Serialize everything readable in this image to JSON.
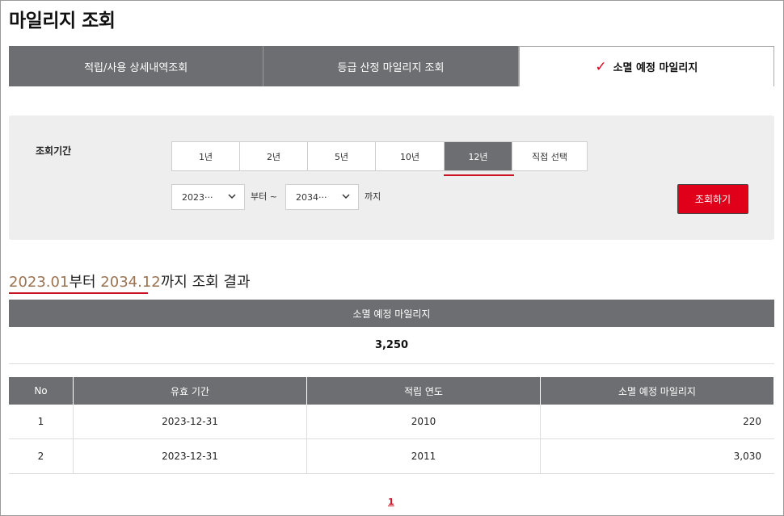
{
  "page": {
    "title": "마일리지 조회"
  },
  "tabs": [
    {
      "label": "적립/사용 상세내역조회",
      "active": false
    },
    {
      "label": "등급 산정 마일리지 조회",
      "active": false
    },
    {
      "label": "소멸 예정 마일리지",
      "active": true
    }
  ],
  "search": {
    "period_label": "조회기간",
    "periods": [
      "1년",
      "2년",
      "5년",
      "10년",
      "12년",
      "직접 선택"
    ],
    "selected_period": "12년",
    "from_value": "2023···",
    "from_suffix": "부터 ~",
    "to_value": "2034···",
    "to_suffix": "까지",
    "button_label": "조회하기"
  },
  "result": {
    "from_date": "2023.01",
    "from_text": "부터",
    "to_date": "2034.12",
    "to_text": "까지 조회 결과"
  },
  "summary": {
    "label": "소멸 예정 마일리지",
    "value": "3,250"
  },
  "table": {
    "headers": [
      "No",
      "유효 기간",
      "적립 연도",
      "소멸 예정 마일리지"
    ],
    "rows": [
      [
        "1",
        "2023-12-31",
        "2010",
        "220"
      ],
      [
        "2",
        "2023-12-31",
        "2011",
        "3,030"
      ]
    ]
  },
  "pagination": {
    "current": "1"
  },
  "colors": {
    "accent": "#e1001a",
    "header_gray": "#6d6e71",
    "date_brown": "#9a7352"
  }
}
